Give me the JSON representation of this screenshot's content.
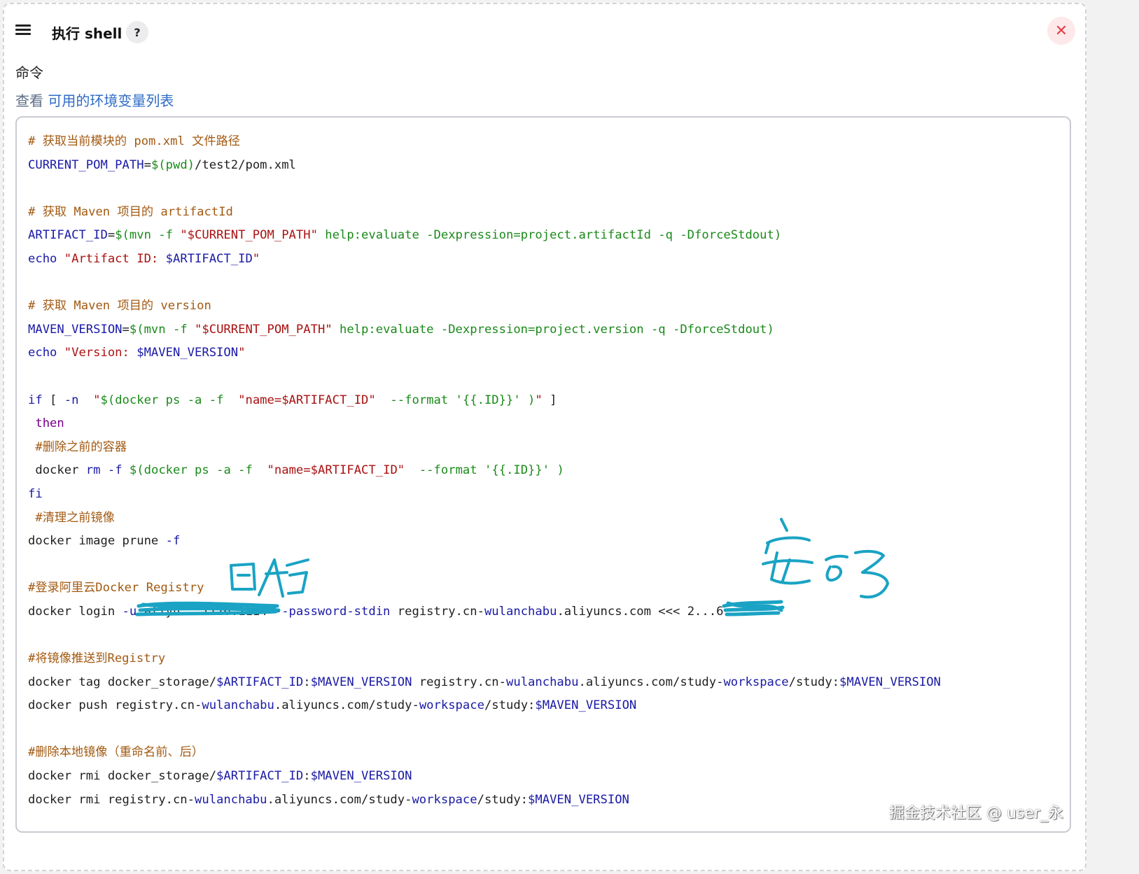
{
  "header": {
    "title": "执行 shell",
    "help_label": "?",
    "close_label": "✕"
  },
  "field": {
    "label": "命令",
    "env_prefix": "查看 ",
    "env_link": "可用的环境变量列表"
  },
  "code_lines": [
    [
      [
        "c",
        "# 获取当前模块的 pom.xml 文件路径"
      ]
    ],
    [
      [
        "v",
        "CURRENT_POM_PATH"
      ],
      [
        "p",
        "="
      ],
      [
        "o",
        "$(pwd)"
      ],
      [
        "p",
        "/test2/pom.xml"
      ]
    ],
    [],
    [
      [
        "c",
        "# 获取 Maven 项目的 artifactId"
      ]
    ],
    [
      [
        "v",
        "ARTIFACT_ID"
      ],
      [
        "p",
        "="
      ],
      [
        "o",
        "$(mvn -f "
      ],
      [
        "s",
        "\"$CURRENT_POM_PATH\""
      ],
      [
        "o",
        " help:evaluate -Dexpression=project.artifactId -q -DforceStdout)"
      ]
    ],
    [
      [
        "v",
        "echo "
      ],
      [
        "s",
        "\"Artifact ID: "
      ],
      [
        "v",
        "$ARTIFACT_ID"
      ],
      [
        "s",
        "\""
      ]
    ],
    [],
    [
      [
        "c",
        "# 获取 Maven 项目的 version"
      ]
    ],
    [
      [
        "v",
        "MAVEN_VERSION"
      ],
      [
        "p",
        "="
      ],
      [
        "o",
        "$(mvn -f "
      ],
      [
        "s",
        "\"$CURRENT_POM_PATH\""
      ],
      [
        "o",
        " help:evaluate -Dexpression=project.version -q -DforceStdout)"
      ]
    ],
    [
      [
        "v",
        "echo "
      ],
      [
        "s",
        "\"Version: "
      ],
      [
        "v",
        "$MAVEN_VERSION"
      ],
      [
        "s",
        "\""
      ]
    ],
    [],
    [
      [
        "v",
        "if"
      ],
      [
        "p",
        " [ "
      ],
      [
        "v",
        "-n"
      ],
      [
        "p",
        "  "
      ],
      [
        "s",
        "\""
      ],
      [
        "o",
        "$(docker ps -a -f  "
      ],
      [
        "s",
        "\"name=$ARTIFACT_ID\""
      ],
      [
        "o",
        "  --format '{{.ID}}' )"
      ],
      [
        "s",
        "\""
      ],
      [
        "p",
        " ]"
      ]
    ],
    [
      [
        "k",
        " then"
      ]
    ],
    [
      [
        "c",
        " #删除之前的容器"
      ]
    ],
    [
      [
        "p",
        " docker "
      ],
      [
        "v",
        "rm"
      ],
      [
        "p",
        " "
      ],
      [
        "v",
        "-f"
      ],
      [
        "p",
        " "
      ],
      [
        "o",
        "$(docker ps -a -f  "
      ],
      [
        "s",
        "\"name=$ARTIFACT_ID\""
      ],
      [
        "o",
        "  --format '{{.ID}}' )"
      ]
    ],
    [
      [
        "v",
        "fi"
      ]
    ],
    [
      [
        "c",
        " #清理之前镜像"
      ]
    ],
    [
      [
        "p",
        "docker image prune "
      ],
      [
        "v",
        "-f"
      ]
    ],
    [],
    [
      [
        "c",
        "#登录阿里云Docker Registry"
      ]
    ],
    [
      [
        "p",
        "docker login "
      ],
      [
        "v",
        "-u"
      ],
      [
        "p",
        " aliyu...1126:1114 "
      ],
      [
        "v",
        "--password-stdin"
      ],
      [
        "p",
        " registry.cn-"
      ],
      [
        "v",
        "wulanchabu"
      ],
      [
        "p",
        ".aliyuncs.com <<< 2...6"
      ]
    ],
    [],
    [
      [
        "c",
        "#将镜像推送到Registry"
      ]
    ],
    [
      [
        "p",
        "docker tag docker_storage/"
      ],
      [
        "v",
        "$ARTIFACT_ID"
      ],
      [
        "p",
        ":"
      ],
      [
        "v",
        "$MAVEN_VERSION"
      ],
      [
        "p",
        " registry.cn-"
      ],
      [
        "v",
        "wulanchabu"
      ],
      [
        "p",
        ".aliyuncs.com/study-"
      ],
      [
        "v",
        "workspace"
      ],
      [
        "p",
        "/study:"
      ],
      [
        "v",
        "$MAVEN_VERSION"
      ]
    ],
    [
      [
        "p",
        "docker push registry.cn-"
      ],
      [
        "v",
        "wulanchabu"
      ],
      [
        "p",
        ".aliyuncs.com/study-"
      ],
      [
        "v",
        "workspace"
      ],
      [
        "p",
        "/study:"
      ],
      [
        "v",
        "$MAVEN_VERSION"
      ]
    ],
    [],
    [
      [
        "c",
        "#删除本地镜像（重命名前、后）"
      ]
    ],
    [
      [
        "p",
        "docker rmi docker_storage/"
      ],
      [
        "v",
        "$ARTIFACT_ID"
      ],
      [
        "p",
        ":"
      ],
      [
        "v",
        "$MAVEN_VERSION"
      ]
    ],
    [
      [
        "p",
        "docker rmi registry.cn-"
      ],
      [
        "v",
        "wulanchabu"
      ],
      [
        "p",
        ".aliyuncs.com/study-"
      ],
      [
        "v",
        "workspace"
      ],
      [
        "p",
        "/study:"
      ],
      [
        "v",
        "$MAVEN_VERSION"
      ]
    ]
  ],
  "colors": {
    "comment": "#a35a12",
    "variable": "#1a1aa6",
    "keyword": "#770088",
    "string": "#a11",
    "command": "#1a8a1a",
    "annotation": "#1aa3c4",
    "close": "#e0414b"
  },
  "watermark": "掘金技术社区 @ user_永"
}
